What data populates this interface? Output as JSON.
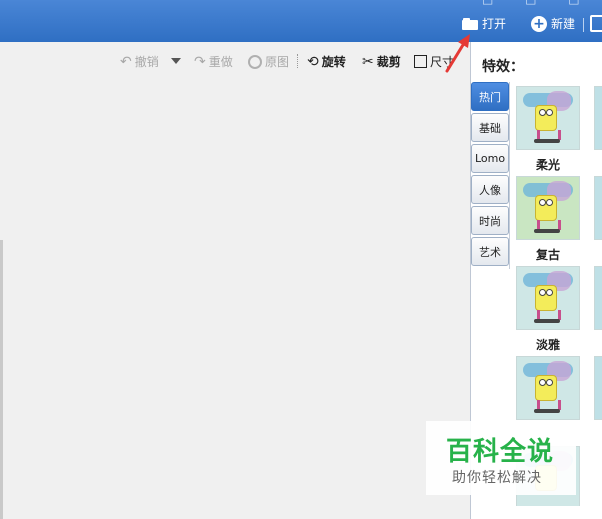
{
  "topbar": {
    "open_label": "打开",
    "new_label": "新建",
    "partial_text": "□ □ □"
  },
  "toolbar": {
    "undo_label": "撤销",
    "redo_label": "重做",
    "original_label": "原图",
    "rotate_label": "旋转",
    "crop_label": "裁剪",
    "size_label": "尺寸"
  },
  "panel": {
    "title": "特效：",
    "tabs": [
      "热门",
      "基础",
      "Lomo",
      "人像",
      "时尚",
      "艺术"
    ],
    "active_tab": "热门",
    "effects": [
      {
        "label": "柔光"
      },
      {
        "label": "复古"
      },
      {
        "label": "淡雅"
      },
      {
        "label": ""
      },
      {
        "label": ""
      }
    ]
  },
  "watermark": {
    "title": "百科全说",
    "subtitle": "助你轻松解决"
  },
  "colors": {
    "topbar": "#2f6fc3",
    "active_tab": "#2f6fc3",
    "watermark_green": "#27b24a",
    "arrow_red": "#e53935"
  }
}
